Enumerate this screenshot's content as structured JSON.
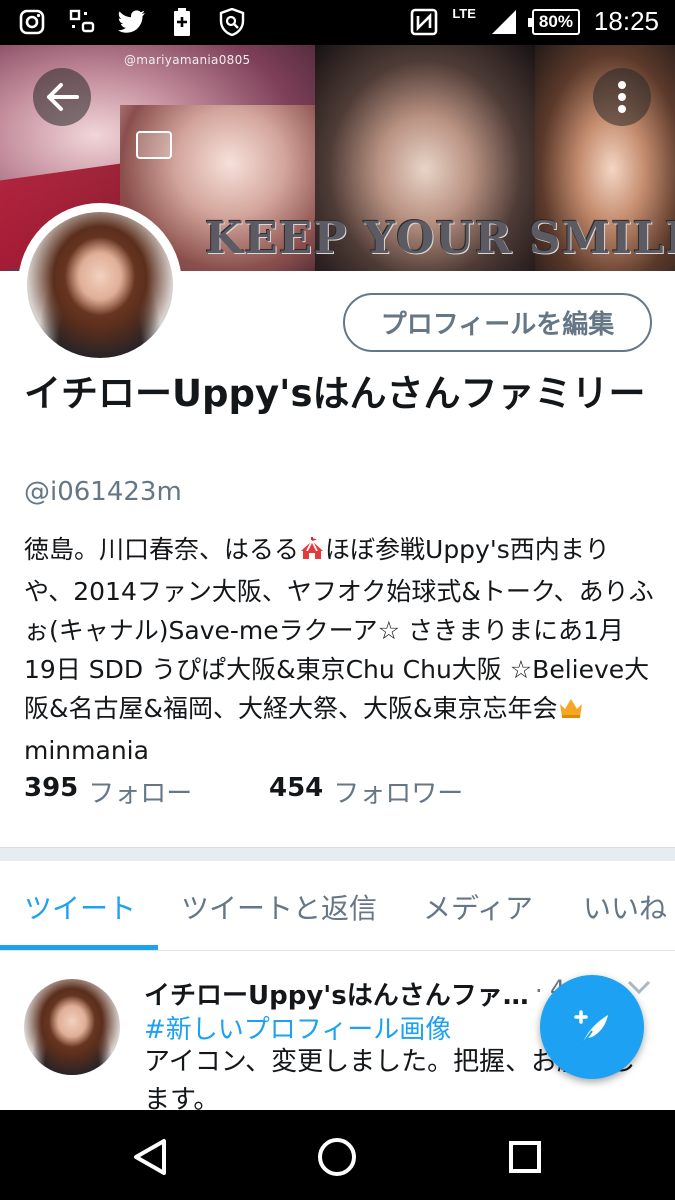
{
  "status_bar": {
    "lte": "LTE",
    "battery": "80%",
    "time": "18:25",
    "icons": [
      "instagram-icon",
      "cast-icon",
      "twitter-icon",
      "battery-saver-icon",
      "shield-icon",
      "nfc-icon",
      "signal-icon",
      "battery-icon"
    ]
  },
  "banner": {
    "watermark": "@mariyamania0805",
    "overlay_text": "KEEP YOUR SMILE"
  },
  "profile": {
    "edit_button": "プロフィールを編集",
    "name": "イチローUppy'sはんさんファミリー",
    "handle": "@i061423m",
    "bio_part1": "徳島。川口春奈、はるる",
    "bio_part2": "ほぼ参戦Uppy's西内まりや、2014ファン大阪、ヤフオク始球式&トーク、ありふぉ(キャナル)Save-meラクーア☆ さきまりまにあ1月19日 SDD うぴぱ大阪&東京Chu Chu大阪 ☆Believe大阪&名古屋&福岡、大経大祭、大阪&東京忘年会",
    "bio_part3": "minmania",
    "following_count": "395",
    "following_label": "フォロー",
    "followers_count": "454",
    "followers_label": "フォロワー"
  },
  "tabs": [
    {
      "label": "ツイート",
      "active": true
    },
    {
      "label": "ツイートと返信",
      "active": false
    },
    {
      "label": "メディア",
      "active": false
    },
    {
      "label": "いいね",
      "active": false
    }
  ],
  "tweet": {
    "author": "イチローUppy'sはんさんファ…",
    "separator": "·",
    "time": "4",
    "hashtag": "#新しいプロフィール画像",
    "text": "アイコン、変更しました。把握、お願いします。"
  },
  "colors": {
    "accent": "#1da1f2",
    "secondary_text": "#657786",
    "primary_text": "#14171a"
  }
}
